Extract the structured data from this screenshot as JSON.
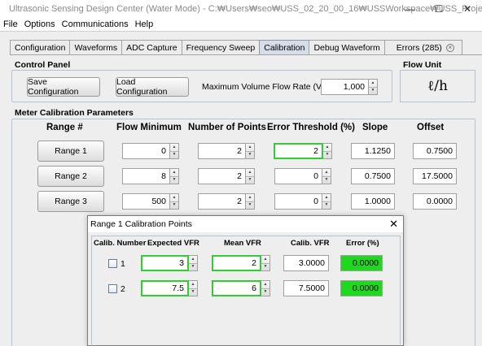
{
  "window": {
    "title": "Ultrasonic Sensing Design Center (Water Mode) - C:₩Users₩seo₩USS_02_20_00_16₩USSWorkspace₩USS_Project",
    "min_glyph": "—",
    "max_glyph": "☐",
    "close_glyph": "✕"
  },
  "menu": [
    "File",
    "Options",
    "Communications",
    "Help"
  ],
  "tabs": [
    {
      "label": "Configuration"
    },
    {
      "label": "Waveforms"
    },
    {
      "label": "ADC Capture"
    },
    {
      "label": "Frequency Sweep"
    },
    {
      "label": "Calibration",
      "active": true
    },
    {
      "label": "Debug Waveform"
    },
    {
      "label": "Errors (285)",
      "closable": true
    }
  ],
  "control_panel": {
    "title": "Control Panel",
    "save_label": "Save Configuration",
    "load_label": "Load Configuration",
    "max_vfr_label": "Maximum Volume Flow Rate (VFR)",
    "max_vfr_value": "1,000"
  },
  "flow_unit": {
    "title": "Flow Unit",
    "value": "ℓ/h"
  },
  "calibration": {
    "title": "Meter Calibration Parameters",
    "headers": {
      "range": "Range #",
      "flow_min": "Flow Minimum",
      "num_points": "Number of Points",
      "error_threshold": "Error Threshold (%)",
      "slope": "Slope",
      "offset": "Offset"
    },
    "rows": [
      {
        "range": "Range 1",
        "flow_min": "0",
        "num_points": "2",
        "error_threshold": "2",
        "slope": "1.1250",
        "offset": "0.7500"
      },
      {
        "range": "Range 2",
        "flow_min": "8",
        "num_points": "2",
        "error_threshold": "0",
        "slope": "0.7500",
        "offset": "17.5000"
      },
      {
        "range": "Range 3",
        "flow_min": "500",
        "num_points": "2",
        "error_threshold": "0",
        "slope": "1.0000",
        "offset": "0.0000"
      }
    ]
  },
  "dialog": {
    "title": "Range 1 Calibration Points",
    "close_glyph": "✕",
    "headers": {
      "calib_number": "Calib. Number",
      "expected_vfr": "Expected VFR",
      "mean_vfr": "Mean VFR",
      "calib_vfr": "Calib. VFR",
      "error_pct": "Error (%)"
    },
    "rows": [
      {
        "num": "1",
        "expected": "3",
        "mean": "2",
        "calib": "3.0000",
        "error": "0.0000"
      },
      {
        "num": "2",
        "expected": "7.5",
        "mean": "6",
        "calib": "7.5000",
        "error": "0.0000"
      }
    ]
  },
  "colors": {
    "accent_green": "#33cc33",
    "error_fill": "#1fd81f",
    "active_tab": "#d5dde8"
  }
}
